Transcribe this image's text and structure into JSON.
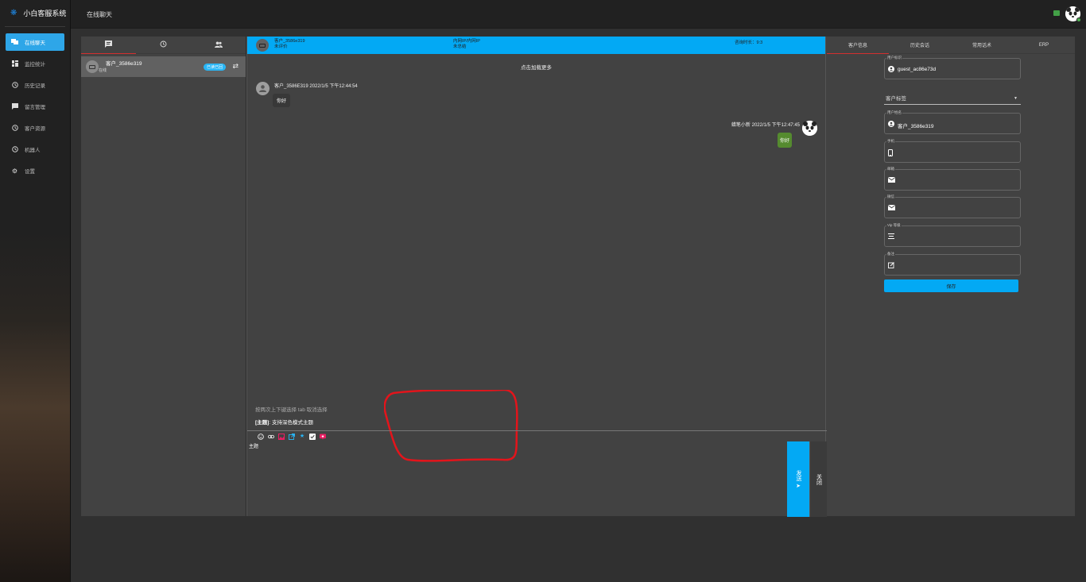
{
  "app": {
    "name": "小白客服系统",
    "page_title": "在线聊天"
  },
  "sidebar": {
    "items": [
      {
        "label": "在线聊天",
        "icon": "chat-icon"
      },
      {
        "label": "监控统计",
        "icon": "dashboard-icon"
      },
      {
        "label": "历史记录",
        "icon": "clock-icon"
      },
      {
        "label": "留言管理",
        "icon": "message-icon"
      },
      {
        "label": "客户资源",
        "icon": "clock-icon"
      },
      {
        "label": "机器人",
        "icon": "clock-icon"
      },
      {
        "label": "设置",
        "icon": "gear-icon"
      }
    ]
  },
  "session": {
    "name": "客户_3586e319",
    "sub": "在线",
    "badge": "已读已回"
  },
  "chat_header": {
    "customer": "客户_3586e319",
    "status": "未评价",
    "network": "内网IP/内网IP",
    "summary": "未总结",
    "duration": "咨询时长：9:3"
  },
  "chat": {
    "load_more": "点击加载更多",
    "messages": [
      {
        "side": "left",
        "sender": "客户_3586E319",
        "time": "2022/1/5 下午12:44:54",
        "text": "你好"
      },
      {
        "side": "right",
        "sender": "蜡笔小新",
        "time": "2022/1/5 下午12:47:45",
        "text": "你好"
      }
    ]
  },
  "editor": {
    "hint": "按两次上下键选择 tab 取消选择",
    "suggestion_tag": "[主题]",
    "suggestion_text": ": 支持深色模式主题",
    "input_text": "主题",
    "send_label": "发送",
    "close_label": "关闭"
  },
  "right_panel": {
    "tabs": [
      "客户信息",
      "历史会话",
      "常用话术",
      "ERP"
    ],
    "fields": [
      {
        "label": "用户标识",
        "value": "guest_ac86e73d",
        "icon": "account-icon"
      },
      {
        "label": "用户姓名",
        "value": "客户_3586e319",
        "icon": "account-icon"
      },
      {
        "label": "手机",
        "value": "",
        "icon": "phone-icon"
      },
      {
        "label": "邮箱",
        "value": "",
        "icon": "mail-icon"
      },
      {
        "label": "微信",
        "value": "",
        "icon": "mail-icon"
      },
      {
        "label": "Vip 等级",
        "value": "",
        "icon": "vip-icon"
      },
      {
        "label": "备注",
        "value": "",
        "icon": "note-icon"
      }
    ],
    "tag_select_placeholder": "客户标签",
    "save_label": "保存"
  },
  "colors": {
    "accent": "#03a9f4",
    "sidebar_active": "#2ea6e8",
    "send_bubble": "#558b2f",
    "tab_indicator": "#d32f2f"
  }
}
